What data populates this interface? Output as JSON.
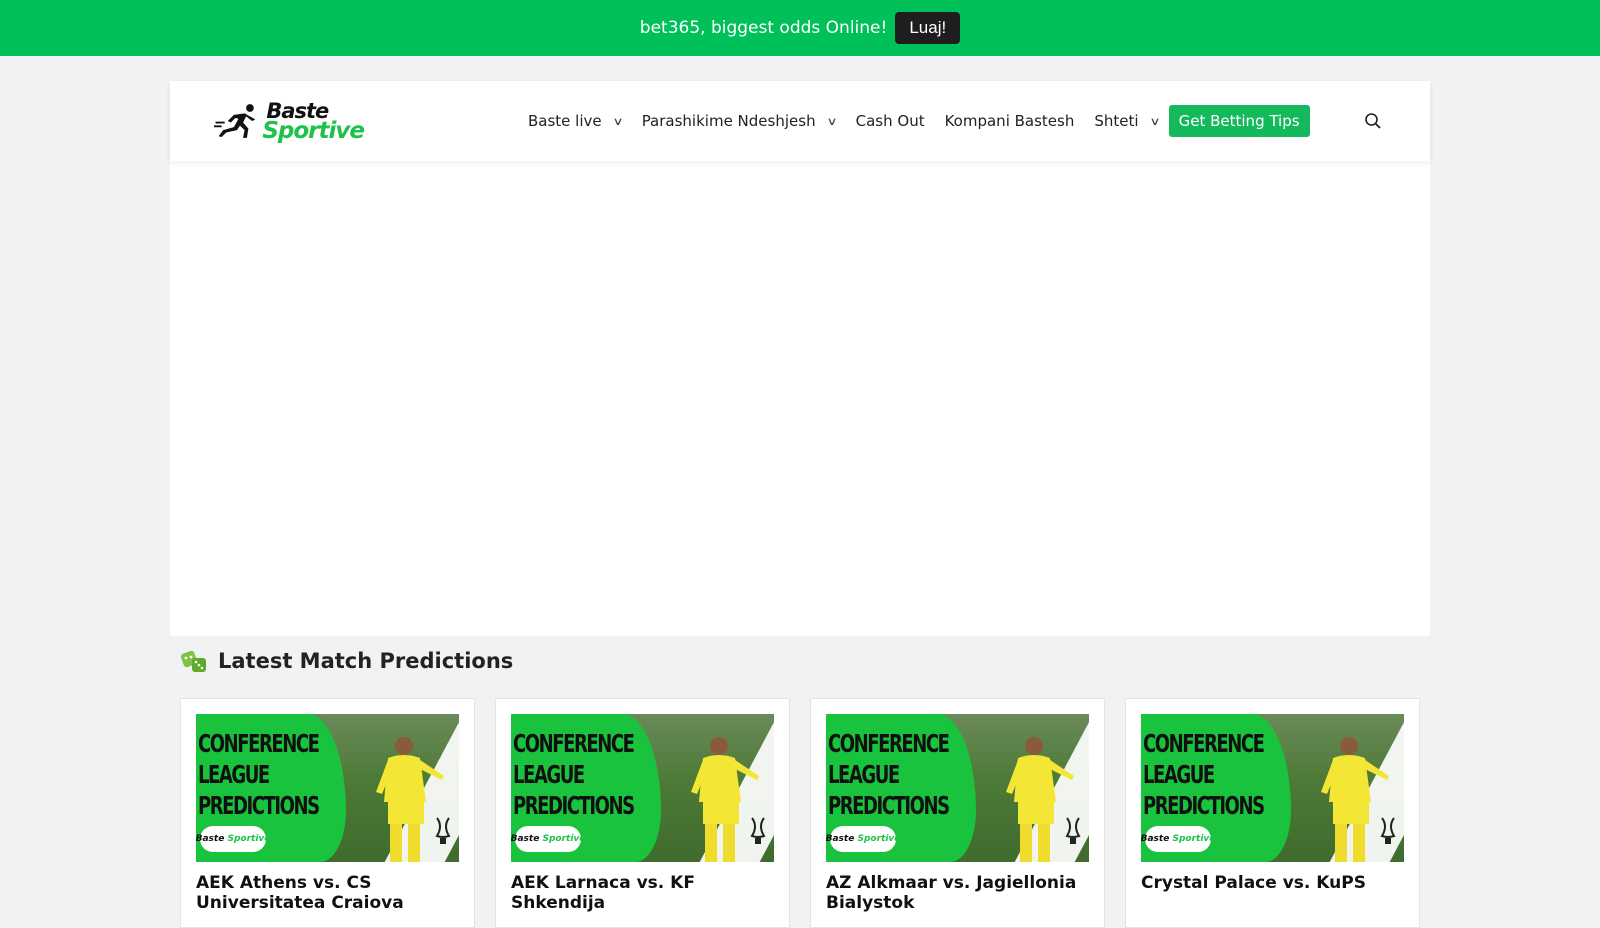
{
  "banner": {
    "text": "bet365, biggest odds Online!",
    "button_label": "Luaj!"
  },
  "header": {
    "logo_top": "Baste",
    "logo_bottom": "Sportive",
    "nav": [
      {
        "label": "Baste live",
        "has_dropdown": true
      },
      {
        "label": "Parashikime Ndeshjesh",
        "has_dropdown": true
      },
      {
        "label": "Cash Out",
        "has_dropdown": false
      },
      {
        "label": "Kompani Bastesh",
        "has_dropdown": false
      },
      {
        "label": "Shteti",
        "has_dropdown": true
      }
    ],
    "cta_label": "Get Betting Tips",
    "search_icon": "search-icon"
  },
  "section": {
    "title": "Latest Match Predictions",
    "icon": "dice-icon"
  },
  "cards": [
    {
      "thumb_headline": [
        "CONFERENCE",
        "LEAGUE",
        "PREDICTIONS"
      ],
      "thumb_logo_top": "Baste",
      "thumb_logo_bottom": "Sportive",
      "title": "AEK Athens vs. CS Universitatea Craiova"
    },
    {
      "thumb_headline": [
        "CONFERENCE",
        "LEAGUE",
        "PREDICTIONS"
      ],
      "thumb_logo_top": "Baste",
      "thumb_logo_bottom": "Sportive",
      "title": "AEK Larnaca vs. KF Shkendija"
    },
    {
      "thumb_headline": [
        "CONFERENCE",
        "LEAGUE",
        "PREDICTIONS"
      ],
      "thumb_logo_top": "Baste",
      "thumb_logo_bottom": "Sportive",
      "title": "AZ Alkmaar vs. Jagiellonia Bialystok"
    },
    {
      "thumb_headline": [
        "CONFERENCE",
        "LEAGUE",
        "PREDICTIONS"
      ],
      "thumb_logo_top": "Baste",
      "thumb_logo_bottom": "Sportive",
      "title": "Crystal Palace vs. KuPS"
    }
  ],
  "colors": {
    "brand_green": "#00c05a",
    "cta_green": "#13b95a",
    "banner_button": "#1e1e1e"
  }
}
